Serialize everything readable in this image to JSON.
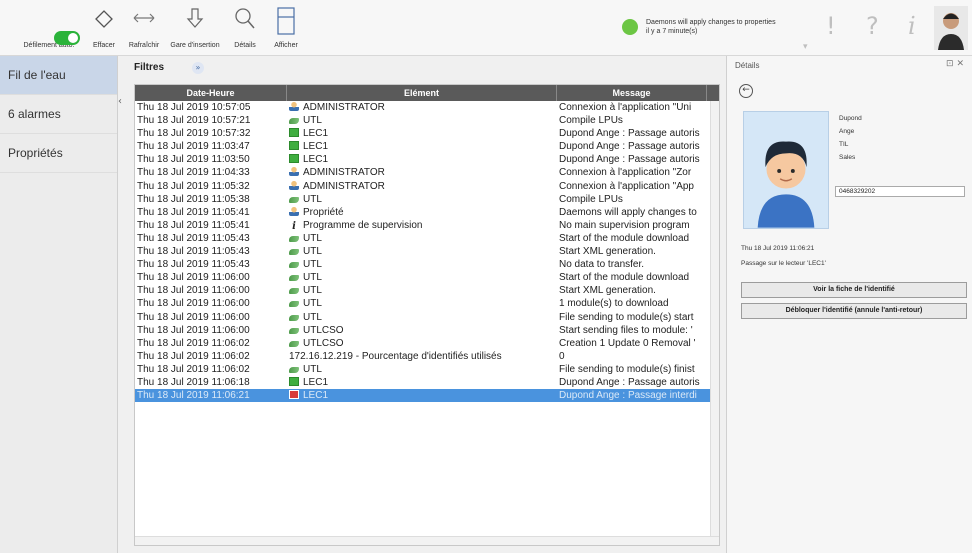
{
  "toolbar": {
    "autoscroll_label": "Défilement auto.",
    "clear_label": "Effacer",
    "refresh_label": "Rafraîchir",
    "stop_insertion_label": "Gare d'insertion",
    "details_label": "Détails",
    "display_label": "Afficher",
    "status_line1": "Daemons will apply changes to properties",
    "status_line2": "il y a 7 minute(s)",
    "status_color": "#6cc644"
  },
  "nav": {
    "items": [
      {
        "label": "Fil de l'eau",
        "active": true
      },
      {
        "label": "6 alarmes"
      },
      {
        "label": "Propriétés"
      }
    ]
  },
  "filters": {
    "label": "Filtres"
  },
  "grid": {
    "headers": [
      "Date-Heure",
      "Elément",
      "Message"
    ],
    "rows": [
      {
        "date": "Thu 18 Jul 2019 10:57:05",
        "icon": "user-icon",
        "element": "ADMINISTRATOR",
        "message": "Connexion à l'application \"Uni"
      },
      {
        "date": "Thu 18 Jul 2019 10:57:21",
        "icon": "utl-icon",
        "element": "UTL",
        "message": "Compile LPUs"
      },
      {
        "date": "Thu 18 Jul 2019 10:57:32",
        "icon": "reader-icon",
        "element": "LEC1",
        "message": "Dupond Ange : Passage autoris"
      },
      {
        "date": "Thu 18 Jul 2019 11:03:47",
        "icon": "reader-icon",
        "element": "LEC1",
        "message": "Dupond Ange : Passage autoris"
      },
      {
        "date": "Thu 18 Jul 2019 11:03:50",
        "icon": "reader-icon",
        "element": "LEC1",
        "message": "Dupond Ange : Passage autoris"
      },
      {
        "date": "Thu 18 Jul 2019 11:04:33",
        "icon": "user-icon",
        "element": "ADMINISTRATOR",
        "message": "Connexion à l'application \"Zor"
      },
      {
        "date": "Thu 18 Jul 2019 11:05:32",
        "icon": "user-icon",
        "element": "ADMINISTRATOR",
        "message": "Connexion à l'application \"App"
      },
      {
        "date": "Thu 18 Jul 2019 11:05:38",
        "icon": "utl-icon",
        "element": "UTL",
        "message": "Compile LPUs"
      },
      {
        "date": "Thu 18 Jul 2019 11:05:41",
        "icon": "user-icon",
        "element": "Propriété",
        "message": "Daemons will apply changes to"
      },
      {
        "date": "Thu 18 Jul 2019 11:05:41",
        "icon": "info-icon",
        "element": "Programme de supervision",
        "message": "No main supervision program"
      },
      {
        "date": "Thu 18 Jul 2019 11:05:43",
        "icon": "utl-icon",
        "element": "UTL",
        "message": "Start of the module download"
      },
      {
        "date": "Thu 18 Jul 2019 11:05:43",
        "icon": "utl-icon",
        "element": "UTL",
        "message": "Start XML generation."
      },
      {
        "date": "Thu 18 Jul 2019 11:05:43",
        "icon": "utl-icon",
        "element": "UTL",
        "message": "No data to transfer."
      },
      {
        "date": "Thu 18 Jul 2019 11:06:00",
        "icon": "utl-icon",
        "element": "UTL",
        "message": "Start of the module download"
      },
      {
        "date": "Thu 18 Jul 2019 11:06:00",
        "icon": "utl-icon",
        "element": "UTL",
        "message": "Start XML generation."
      },
      {
        "date": "Thu 18 Jul 2019 11:06:00",
        "icon": "utl-icon",
        "element": "UTL",
        "message": "1 module(s) to download"
      },
      {
        "date": "Thu 18 Jul 2019 11:06:00",
        "icon": "utl-icon",
        "element": "UTL",
        "message": "File sending to module(s) start"
      },
      {
        "date": "Thu 18 Jul 2019 11:06:00",
        "icon": "utl-icon",
        "element": "UTLCSO",
        "message": "Start sending files to module: '"
      },
      {
        "date": "Thu 18 Jul 2019 11:06:02",
        "icon": "utl-icon",
        "element": "UTLCSO",
        "message": "Creation 1 Update 0 Removal '"
      },
      {
        "date": "Thu 18 Jul 2019 11:06:02",
        "icon": "none",
        "element": "172.16.12.219 - Pourcentage d'identifiés utilisés",
        "message": "0"
      },
      {
        "date": "Thu 18 Jul 2019 11:06:02",
        "icon": "utl-icon",
        "element": "UTL",
        "message": "File sending to module(s) finist"
      },
      {
        "date": "Thu 18 Jul 2019 11:06:18",
        "icon": "reader-icon",
        "element": "LEC1",
        "message": "Dupond Ange : Passage autoris"
      },
      {
        "date": "Thu 18 Jul 2019 11:06:21",
        "icon": "reader-denied-icon",
        "element": "LEC1",
        "message": "Dupond Ange : Passage interdi",
        "selected": true
      }
    ]
  },
  "details": {
    "title": "Détails",
    "lastname": "Dupond",
    "firstname": "Ange",
    "company": "TIL",
    "department": "Sales",
    "badge": "0468329202",
    "event_time": "Thu 18 Jul 2019 11:06:21",
    "event_text": "Passage sur le lecteur 'LEC1'",
    "btn_view": "Voir la fiche de l'identifié",
    "btn_unlock": "Débloquer l'identifié (annule l'anti-retour)"
  }
}
